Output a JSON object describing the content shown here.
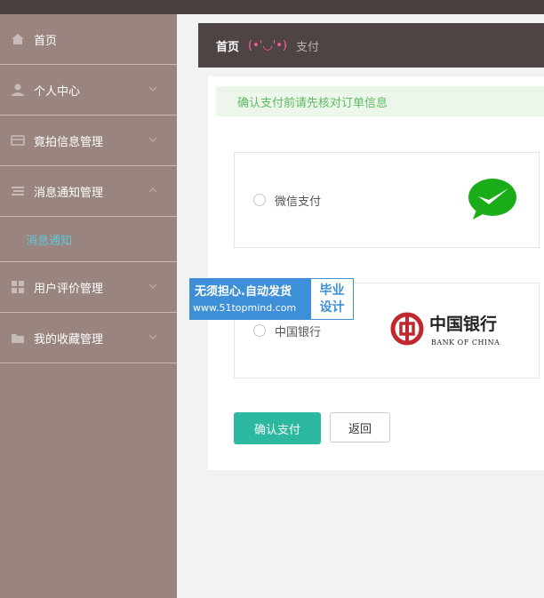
{
  "sidebar": {
    "items": [
      {
        "label": "首页",
        "icon": "home-icon"
      },
      {
        "label": "个人中心",
        "icon": "user-icon"
      },
      {
        "label": "竟拍信息管理",
        "icon": "card-icon"
      },
      {
        "label": "消息通知管理",
        "icon": "list-icon"
      },
      {
        "label": "用户评价管理",
        "icon": "grid-icon"
      },
      {
        "label": "我的收藏管理",
        "icon": "folder-icon"
      }
    ],
    "subitem": {
      "label": "消息通知"
    }
  },
  "breadcrumb": {
    "home": "首页",
    "face": "(•'◡'•)",
    "current": "支付"
  },
  "notice": {
    "text": "确认支付前请先核对订单信息"
  },
  "payment": {
    "wechat": {
      "label": "微信支付",
      "icon": "wechat-logo"
    },
    "boc": {
      "label": "中国银行",
      "logo_cn": "中国银行",
      "logo_en": "BANK OF CHINA"
    }
  },
  "buttons": {
    "confirm": "确认支付",
    "back": "返回"
  },
  "watermark": {
    "line1": "无须担心.自动发货",
    "line2": "www.51topmind.com",
    "right1": "毕业",
    "right2": "设计"
  },
  "colors": {
    "sidebar": "#9a8480",
    "breadcrumb": "#4e4444",
    "accent": "#2db8a0",
    "sub_active": "#5ec8d6",
    "notice_text": "#5dbb63"
  }
}
